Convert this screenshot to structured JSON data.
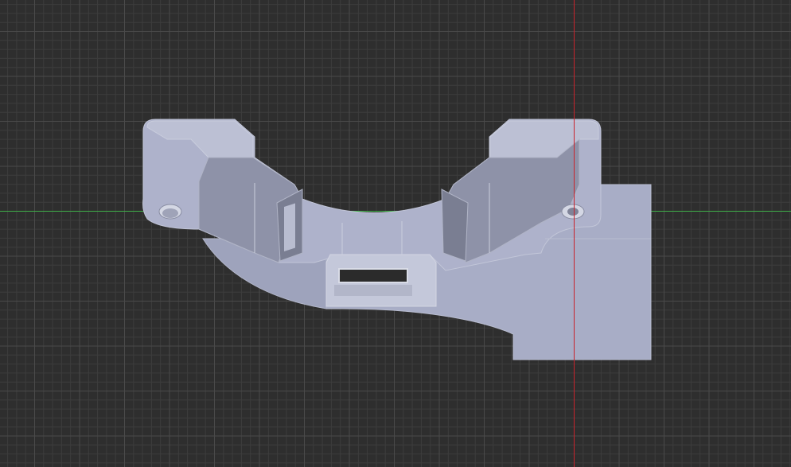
{
  "viewport": {
    "background_color": "#2e2e2e",
    "grid_minor_color": "#3d3d3d",
    "grid_major_color": "#4a4a4a",
    "x_axis_color": "#3fae49",
    "y_axis_color": "#c8232c"
  },
  "model": {
    "body_color": "#a8adc6",
    "highlight_color": "#c4c8da",
    "shade_color": "#8e92a8",
    "dark_color": "#7a7e92",
    "slot_color": "#2b2b2b"
  }
}
